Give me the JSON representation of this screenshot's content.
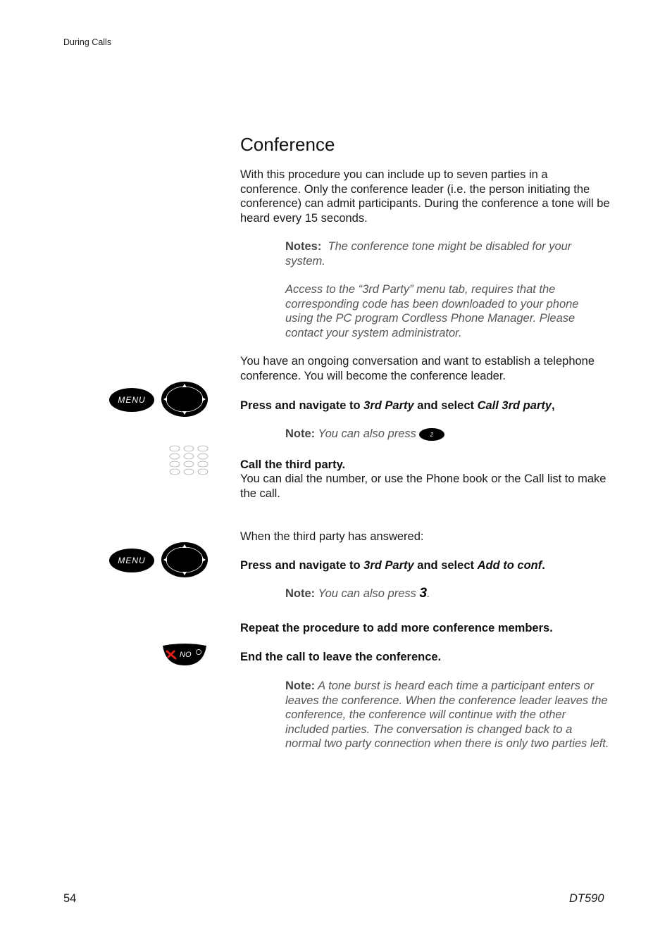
{
  "header": {
    "section": "During Calls"
  },
  "title": "Conference",
  "intro": "With this procedure you can include up to seven parties in a conference. Only the conference leader (i.e. the person initiating the conference) can admit participants. During the conference a tone will be heard every 15 seconds.",
  "notes_block": {
    "label": "Notes:",
    "text1": "The conference tone might be disabled for your system.",
    "text2": "Access to the “3rd Party” menu tab, requires that the corresponding code has been downloaded to your phone using the PC program Cordless Phone Manager. Please contact your system administrator."
  },
  "context1": "You have an ongoing conversation and want to establish a telephone conference. You will become the conference leader.",
  "step1": {
    "prefix": "Press and navigate to ",
    "menu": "3rd Party",
    "middle": " and select ",
    "item": "Call 3rd party",
    "suffix": ","
  },
  "note1": {
    "label": "Note:",
    "text": "You can also press"
  },
  "step2": {
    "title": "Call the third party.",
    "text": "You can dial the number, or use the Phone book or the Call list to make the call."
  },
  "context2": "When the third party has answered:",
  "step3": {
    "prefix": "Press and navigate to ",
    "menu": "3rd Party",
    "middle": " and select ",
    "item": "Add to conf",
    "suffix": "."
  },
  "note2": {
    "label": "Note:",
    "text": "You can also press",
    "key": "3",
    "suffix": "."
  },
  "step4": "Repeat the procedure to add more conference members.",
  "step5": "End the call to leave the conference.",
  "note3": {
    "label": "Note:",
    "text": "A tone burst is heard each time a participant enters or leaves the conference. When the conference leader leaves the conference, the conference will continue with the other included parties. The conversation is changed back to a normal two party connection when there is only two parties left."
  },
  "keys": {
    "menu_label": "MENU",
    "no_label": "NO"
  },
  "footer": {
    "page_number": "54",
    "model": "DT590"
  }
}
